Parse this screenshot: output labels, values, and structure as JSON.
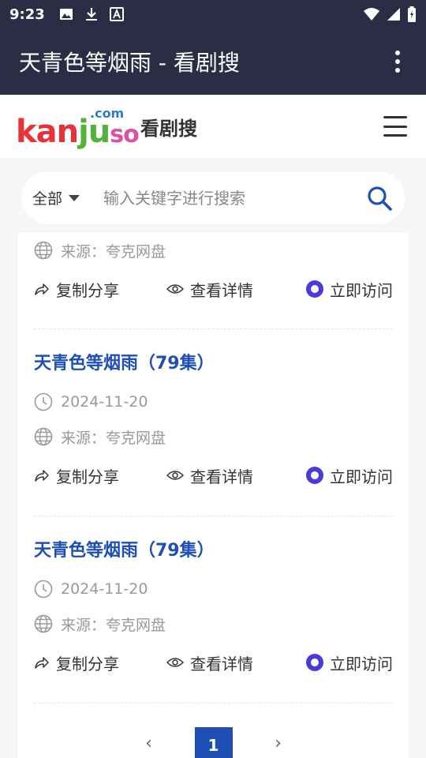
{
  "status_bar": {
    "time": "9:23",
    "left_icons": [
      "image-icon",
      "download-icon",
      "font-icon"
    ],
    "right_icons": [
      "wifi-icon",
      "signal-icon",
      "battery-icon"
    ]
  },
  "app_bar": {
    "title": "天青色等烟雨 - 看剧搜",
    "overflow_icon": "more-vert-icon"
  },
  "site_header": {
    "logo": {
      "main_k": "kan",
      "main_u": "ju",
      "main_so": "so",
      "com": ".com"
    },
    "site_name": "看剧搜",
    "menu_icon": "hamburger-icon"
  },
  "search": {
    "scope": "全部",
    "placeholder": "输入关键字进行搜索",
    "value": "",
    "icon": "search-icon"
  },
  "results": [
    {
      "partial": true,
      "source": "来源：夸克网盘",
      "actions": {
        "share": "复制分享",
        "detail": "查看详情",
        "visit": "立即访问"
      }
    },
    {
      "title": "天青色等烟雨（79集）",
      "date": "2024-11-20",
      "source": "来源：夸克网盘",
      "actions": {
        "share": "复制分享",
        "detail": "查看详情",
        "visit": "立即访问"
      }
    },
    {
      "title": "天青色等烟雨（79集）",
      "date": "2024-11-20",
      "source": "来源：夸克网盘",
      "actions": {
        "share": "复制分享",
        "detail": "查看详情",
        "visit": "立即访问"
      }
    }
  ],
  "pagination": {
    "prev": "‹",
    "current": "1",
    "next": "›"
  },
  "colors": {
    "bar_bg": "#2b2d44",
    "title_blue": "#1f4fb5",
    "visit_purple": "#4a3bd8"
  }
}
